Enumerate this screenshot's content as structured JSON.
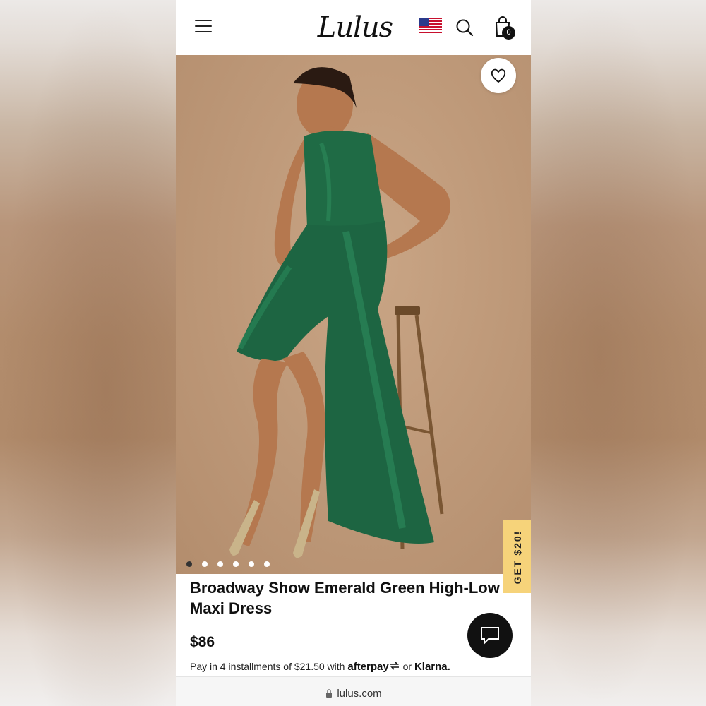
{
  "header": {
    "menu_icon": "hamburger-menu-icon",
    "logo_text": "Lulus",
    "flag_icon": "us-flag-icon",
    "search_icon": "search-icon",
    "bag_icon": "shopping-bag-icon",
    "bag_count": "0"
  },
  "hero": {
    "wishlist_icon": "heart-icon",
    "carousel_dots": 6,
    "active_dot": 0,
    "image_description_colors": {
      "background": "#c09b7b",
      "dress": "#1f6b45"
    }
  },
  "promo": {
    "label": "GET $20!",
    "color": "#f6d37a"
  },
  "product": {
    "title": "Broadway Show Emerald Green High-Low Maxi Dress",
    "price": "$86",
    "installments_text": "Pay in 4 installments of $21.50 with",
    "afterpay": "afterpay",
    "or_text": "or",
    "klarna": "Klarna."
  },
  "chat": {
    "icon": "chat-bubble-icon"
  },
  "browser": {
    "url": "lulus.com",
    "lock_icon": "lock-icon"
  }
}
